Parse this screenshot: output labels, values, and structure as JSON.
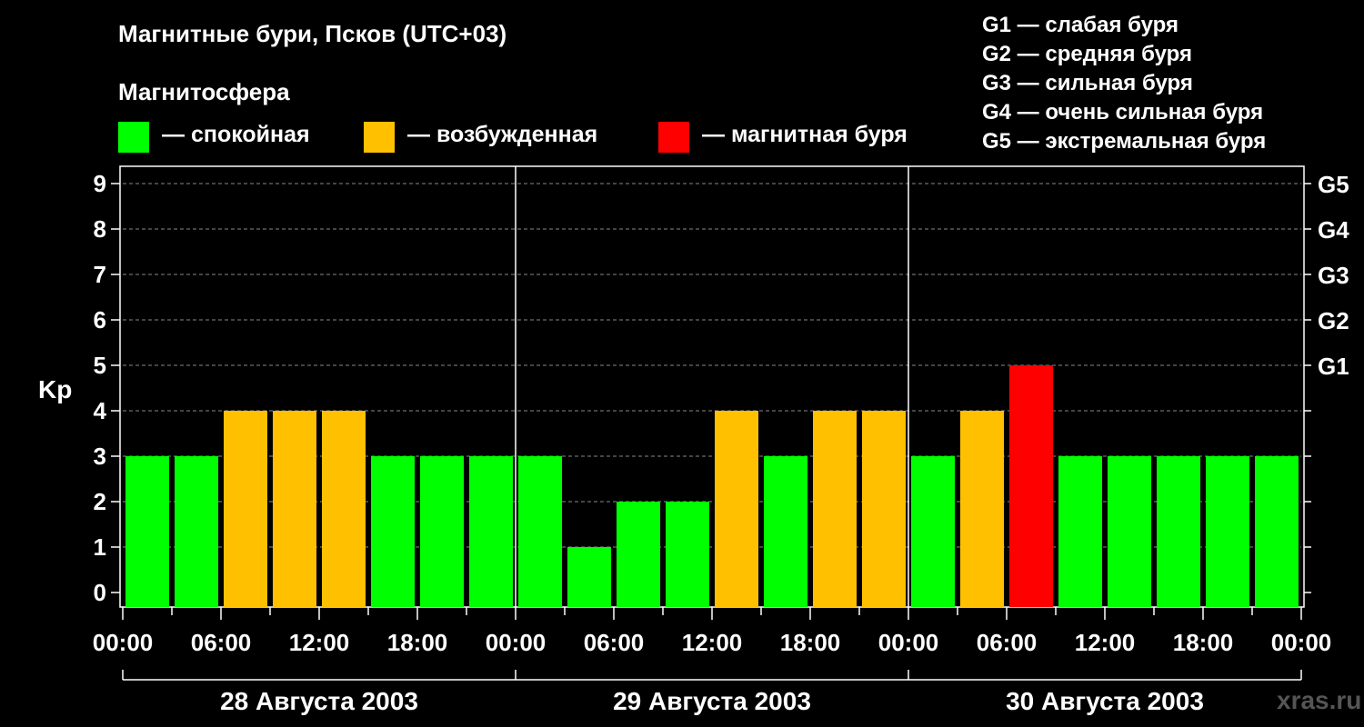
{
  "title": "Магнитные бури, Псков (UTC+03)",
  "subtitle": "Магнитосфера",
  "legend": [
    {
      "label": "— спокойная",
      "color": "#00ff00"
    },
    {
      "label": "— возбужденная",
      "color": "#ffc000"
    },
    {
      "label": "— магнитная буря",
      "color": "#ff0000"
    }
  ],
  "g_legend": [
    "G1 — слабая буря",
    "G2 — средняя буря",
    "G3 — сильная буря",
    "G4 — очень сильная буря",
    "G5 — экстремальная буря"
  ],
  "watermark": "xras.ru",
  "chart_data": {
    "type": "bar",
    "ylabel": "Kp",
    "ylim": [
      0,
      9
    ],
    "yticks": [
      "0",
      "1",
      "2",
      "3",
      "4",
      "5",
      "6",
      "7",
      "8",
      "9"
    ],
    "g_scale": [
      {
        "label": "G1",
        "kp": 5
      },
      {
        "label": "G2",
        "kp": 6
      },
      {
        "label": "G3",
        "kp": 7
      },
      {
        "label": "G4",
        "kp": 8
      },
      {
        "label": "G5",
        "kp": 9
      }
    ],
    "xtick_labels": [
      "00:00",
      "06:00",
      "12:00",
      "18:00",
      "00:00",
      "06:00",
      "12:00",
      "18:00",
      "00:00",
      "06:00",
      "12:00",
      "18:00",
      "00:00"
    ],
    "days": [
      "28 Августа 2003",
      "29 Августа 2003",
      "30 Августа 2003"
    ],
    "values": [
      3,
      3,
      4,
      4,
      4,
      3,
      3,
      3,
      3,
      1,
      2,
      2,
      4,
      3,
      4,
      4,
      3,
      4,
      5,
      3,
      3,
      3,
      3,
      3
    ],
    "colors": {
      "quiet": "#00ff00",
      "active": "#ffc000",
      "storm": "#ff0000"
    },
    "grid": true
  }
}
